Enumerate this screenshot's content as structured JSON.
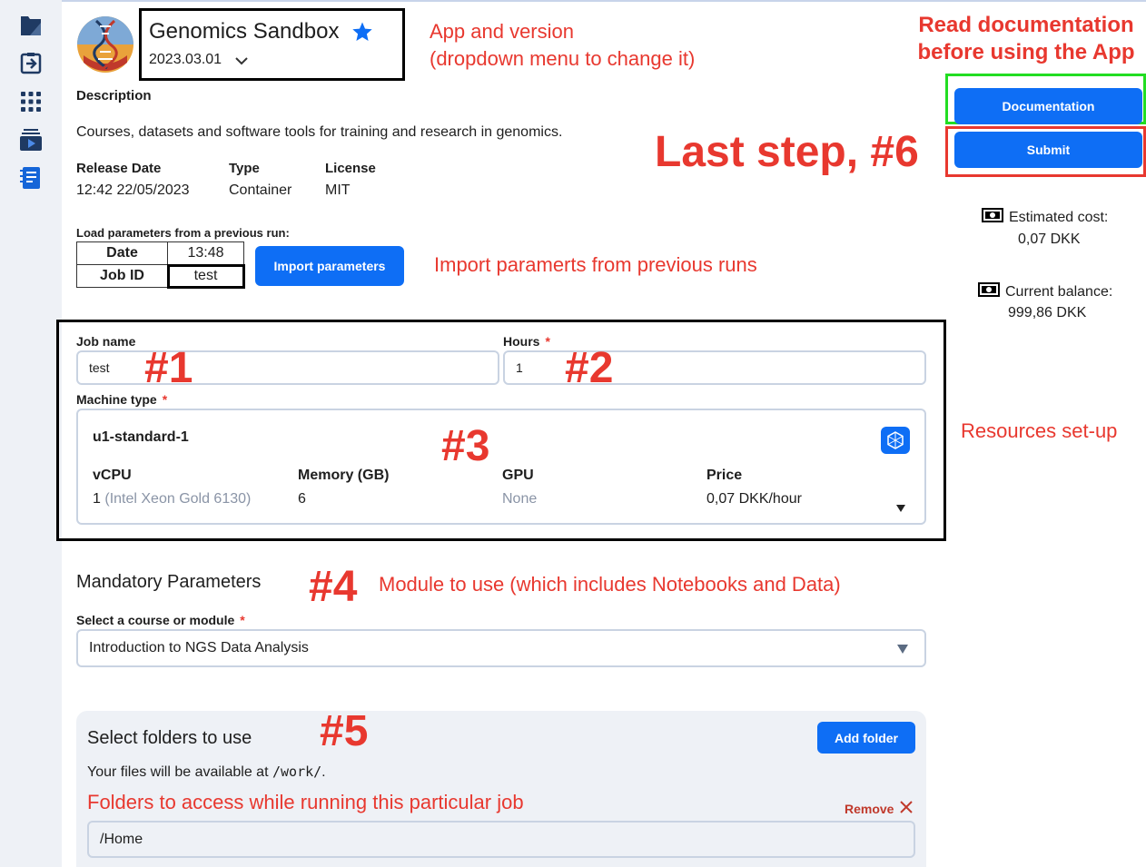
{
  "app": {
    "title": "Genomics Sandbox",
    "version": "2023.03.01",
    "description_heading": "Description",
    "description": "Courses, datasets and software tools for training and research in genomics.",
    "meta": [
      {
        "label": "Release Date",
        "value": "12:42 22/05/2023"
      },
      {
        "label": "Type",
        "value": "Container"
      },
      {
        "label": "License",
        "value": "MIT"
      }
    ]
  },
  "load_params": {
    "heading": "Load parameters from a previous run:",
    "date_label": "Date",
    "date_value": "13:48",
    "job_label": "Job ID",
    "job_value": "test",
    "import_button": "Import parameters"
  },
  "actions": {
    "documentation_button": "Documentation",
    "submit_button": "Submit"
  },
  "cost": {
    "estimated_label": "Estimated cost:",
    "estimated_value": "0,07 DKK",
    "balance_label": "Current balance:",
    "balance_value": "999,86 DKK"
  },
  "resources": {
    "job_name_label": "Job name",
    "job_name_value": "test",
    "hours_label": "Hours",
    "hours_value": "1",
    "required_mark": "*",
    "machine_type_label": "Machine type",
    "machine": {
      "name": "u1-standard-1",
      "vcpu_label": "vCPU",
      "vcpu_value": "1",
      "vcpu_detail": "(Intel Xeon Gold 6130)",
      "memory_label": "Memory (GB)",
      "memory_value": "6",
      "gpu_label": "GPU",
      "gpu_value": "None",
      "price_label": "Price",
      "price_value": "0,07 DKK/hour"
    }
  },
  "mandatory": {
    "heading": "Mandatory Parameters",
    "module_label": "Select a course or module",
    "module_value": "Introduction to NGS Data Analysis"
  },
  "folders": {
    "heading": "Select folders to use",
    "add_button": "Add folder",
    "info_prefix": "Your files will be available at",
    "info_path": "/work/",
    "info_suffix": ".",
    "remove_label": "Remove",
    "folder_value": "/Home"
  },
  "annotations": {
    "app_version_line1": "App and version",
    "app_version_line2": "(dropdown menu to change it)",
    "read_docs_line1": "Read documentation",
    "read_docs_line2": "before using the App",
    "last_step": "Last step, #6",
    "import_params": "Import paramerts from previous runs",
    "resources": "Resources set-up",
    "n1": "#1",
    "n2": "#2",
    "n3": "#3",
    "n4": "#4",
    "n5": "#5",
    "module_note": "Module to use (which includes Notebooks and Data)",
    "folders_note": "Folders to access while running this particular job"
  },
  "colors": {
    "primary": "#0e6ef5",
    "annotation_red": "#e8382f",
    "green_highlight": "#22dd22",
    "sidebar": "#eef1f6"
  },
  "icons": [
    "files-icon",
    "import-icon",
    "apps-grid-icon",
    "jobs-icon",
    "notes-icon",
    "star-icon",
    "chevron-down-icon",
    "money-icon",
    "close-icon",
    "machine-icon"
  ]
}
